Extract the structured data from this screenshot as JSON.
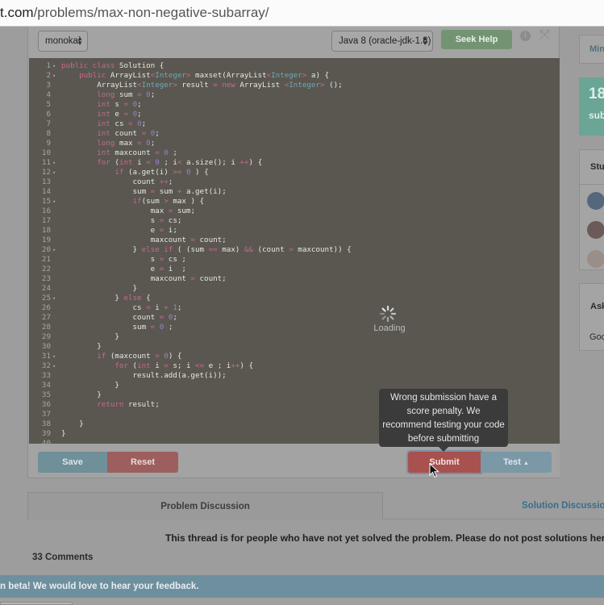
{
  "browser": {
    "url_domain_fragment": "t.com",
    "url_path": "/problems/max-non-negative-subarray/"
  },
  "toolbar": {
    "theme": "monokai",
    "language": "Java 8 (oracle-jdk-1.8)",
    "seek_help_label": "Seek Help",
    "info_icon": "info-icon",
    "expand_icon": "expand-icon"
  },
  "editor": {
    "lines": [
      {
        "n": "1",
        "fold": true,
        "code": "<span class=\"kw\">public class</span> Solution {"
      },
      {
        "n": "2",
        "fold": true,
        "code": "    <span class=\"kw\">public</span> ArrayList<span class=\"op\">&lt;</span><span class=\"ty\">Integer</span><span class=\"op\">&gt;</span> maxset(ArrayList<span class=\"op\">&lt;</span><span class=\"ty\">Integer</span><span class=\"op\">&gt;</span> a) {"
      },
      {
        "n": "3",
        "fold": false,
        "code": "        ArrayList<span class=\"op\">&lt;</span><span class=\"ty\">Integer</span><span class=\"op\">&gt;</span> result <span class=\"op\">=</span> <span class=\"kw\">new</span> ArrayList <span class=\"op\">&lt;</span><span class=\"ty\">Integer</span><span class=\"op\">&gt;</span> ();"
      },
      {
        "n": "4",
        "fold": false,
        "code": "        <span class=\"kw\">long</span> sum <span class=\"op\">=</span> <span class=\"num\">0</span>;"
      },
      {
        "n": "5",
        "fold": false,
        "code": "        <span class=\"kw\">int</span> s <span class=\"op\">=</span> <span class=\"num\">0</span>;"
      },
      {
        "n": "6",
        "fold": false,
        "code": "        <span class=\"kw\">int</span> e <span class=\"op\">=</span> <span class=\"num\">0</span>;"
      },
      {
        "n": "7",
        "fold": false,
        "code": "        <span class=\"kw\">int</span> cs <span class=\"op\">=</span> <span class=\"num\">0</span>;"
      },
      {
        "n": "8",
        "fold": false,
        "code": "        <span class=\"kw\">int</span> count <span class=\"op\">=</span> <span class=\"num\">0</span>;"
      },
      {
        "n": "9",
        "fold": false,
        "code": "        <span class=\"kw\">long</span> max <span class=\"op\">=</span> <span class=\"num\">0</span>;"
      },
      {
        "n": "10",
        "fold": false,
        "code": "        <span class=\"kw\">int</span> maxcount <span class=\"op\">=</span> <span class=\"num\">0</span> ;"
      },
      {
        "n": "11",
        "fold": true,
        "code": "        <span class=\"kw\">for</span> (<span class=\"kw\">int</span> i <span class=\"op\">=</span> <span class=\"num\">0</span> ; i<span class=\"op\">&lt;</span> a.size(); i <span class=\"op\">++</span>) {"
      },
      {
        "n": "12",
        "fold": true,
        "code": "            <span class=\"kw\">if</span> (a.get(i) <span class=\"op\">&gt;=</span> <span class=\"num\">0</span> ) {"
      },
      {
        "n": "13",
        "fold": false,
        "code": "                count <span class=\"op\">++</span>;"
      },
      {
        "n": "14",
        "fold": false,
        "code": "                sum <span class=\"op\">=</span> sum <span class=\"op\">+</span> a.get(i);"
      },
      {
        "n": "15",
        "fold": true,
        "code": "                <span class=\"kw\">if</span>(sum <span class=\"op\">&gt;</span> max ) {"
      },
      {
        "n": "16",
        "fold": false,
        "code": "                    max <span class=\"op\">=</span> sum;"
      },
      {
        "n": "17",
        "fold": false,
        "code": "                    s <span class=\"op\">=</span> cs;"
      },
      {
        "n": "18",
        "fold": false,
        "code": "                    e <span class=\"op\">=</span> i;"
      },
      {
        "n": "19",
        "fold": false,
        "code": "                    maxcount <span class=\"op\">=</span> count;"
      },
      {
        "n": "20",
        "fold": true,
        "code": "                } <span class=\"kw\">else if</span> ( (sum <span class=\"op\">==</span> max) <span class=\"op\">&amp;&amp;</span> (count <span class=\"op\">&gt;</span> maxcount)) {"
      },
      {
        "n": "21",
        "fold": false,
        "code": "                    s <span class=\"op\">=</span> cs ;"
      },
      {
        "n": "22",
        "fold": false,
        "code": "                    e <span class=\"op\">=</span> i  ;"
      },
      {
        "n": "23",
        "fold": false,
        "code": "                    maxcount <span class=\"op\">=</span> count;"
      },
      {
        "n": "24",
        "fold": false,
        "code": "                }"
      },
      {
        "n": "25",
        "fold": true,
        "code": "            } <span class=\"kw\">else</span> {"
      },
      {
        "n": "26",
        "fold": false,
        "code": "                cs <span class=\"op\">=</span> i <span class=\"op\">+</span> <span class=\"num\">1</span>;"
      },
      {
        "n": "27",
        "fold": false,
        "code": "                count <span class=\"op\">=</span> <span class=\"num\">0</span>;"
      },
      {
        "n": "28",
        "fold": false,
        "code": "                sum <span class=\"op\">=</span> <span class=\"num\">0</span> ;"
      },
      {
        "n": "29",
        "fold": false,
        "code": "            }"
      },
      {
        "n": "30",
        "fold": false,
        "code": "        }"
      },
      {
        "n": "31",
        "fold": true,
        "code": "        <span class=\"kw\">if</span> (maxcount <span class=\"op\">&gt;</span> <span class=\"num\">0</span>) {"
      },
      {
        "n": "32",
        "fold": true,
        "code": "            <span class=\"kw\">for</span> (<span class=\"kw\">int</span> i <span class=\"op\">=</span> s; i <span class=\"op\">&lt;=</span> e ; i<span class=\"op\">++</span>) {"
      },
      {
        "n": "33",
        "fold": false,
        "code": "                result.add(a.get(i));"
      },
      {
        "n": "34",
        "fold": false,
        "code": "            }"
      },
      {
        "n": "35",
        "fold": false,
        "code": "        }"
      },
      {
        "n": "36",
        "fold": false,
        "code": "        <span class=\"kw\">return</span> result;"
      },
      {
        "n": "37",
        "fold": false,
        "code": ""
      },
      {
        "n": "38",
        "fold": false,
        "code": "    }"
      },
      {
        "n": "39",
        "fold": false,
        "code": "}"
      },
      {
        "n": "40",
        "fold": false,
        "code": ""
      }
    ],
    "loading_text": "Loading"
  },
  "actions": {
    "save_label": "Save",
    "reset_label": "Reset",
    "submit_label": "Submit",
    "test_label": "Test",
    "tooltip": "Wrong submission have a score penalty. We recommend testing your code before submitting"
  },
  "discussion": {
    "tabs": [
      "Problem Discussion",
      "Solution Discussion"
    ],
    "note": "This thread is for people who have not yet solved the problem. Please do not post solutions here.",
    "comments": "33 Comments"
  },
  "beta_banner": "n beta! We would love to hear your feedback.",
  "sidebar": {
    "min_label": "Min",
    "stat_big": "18",
    "stat_sub": "sub",
    "students_header": "Stu",
    "ask_header": "Ask",
    "ask_body": "Goo"
  },
  "colors": {
    "seek_help": "#739472",
    "submit": "#a8514f",
    "test": "#7a98a6",
    "save": "#6f8f99",
    "reset": "#9c5f5e",
    "editor_bg": "#595750",
    "stat_card": "#6aa595"
  }
}
